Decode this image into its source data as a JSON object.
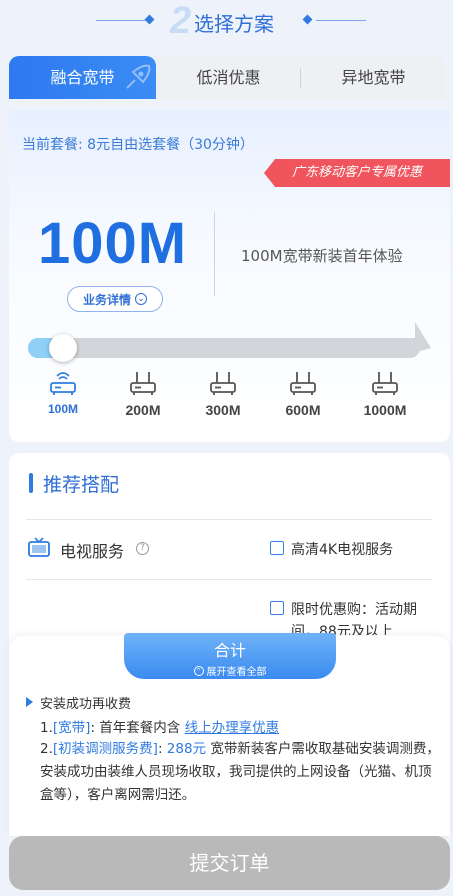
{
  "step": {
    "number": "2",
    "title": "选择方案"
  },
  "tabs": [
    {
      "label": "融合宽带",
      "active": true
    },
    {
      "label": "低消优惠",
      "active": false
    },
    {
      "label": "异地宽带",
      "active": false
    }
  ],
  "package": {
    "current": "当前套餐: 8元自由选套餐（30分钟）",
    "promo_badge": "广东移动客户专属优惠",
    "speed": "100M",
    "description": "100M宽带新装首年体验",
    "detail_button": "业务详情"
  },
  "speed_options": [
    {
      "label": "100M",
      "selected": true
    },
    {
      "label": "200M",
      "selected": false
    },
    {
      "label": "300M",
      "selected": false
    },
    {
      "label": "600M",
      "selected": false
    },
    {
      "label": "1000M",
      "selected": false
    }
  ],
  "recommend": {
    "title": "推荐搭配",
    "tv_label": "电视服务",
    "options": [
      {
        "label": "高清4K电视服务",
        "checked": false
      },
      {
        "label": "限时优惠购：活动期间，88元及以上",
        "checked": false
      }
    ]
  },
  "total": {
    "label": "合计",
    "expand": "展开查看全部"
  },
  "notice": {
    "title": "安装成功再收费",
    "item1_prefix": "1.",
    "item1_tag": "[宽带]",
    "item1_text": ": 首年套餐内含 ",
    "item1_link": "线上办理享优惠",
    "item2_prefix": "2.",
    "item2_tag": "[初装调测服务费]",
    "item2_sep": ": ",
    "item2_price": "288元",
    "item2_text": " 宽带新装客户需收取基础安装调测费，安装成功由装维人员现场收取，我司提供的上网设备（光猫、机顶盒等），客户离网需归还。"
  },
  "submit_label": "提交订单",
  "colors": {
    "primary": "#2f7be0",
    "promo": "#f0545c",
    "submit_disabled": "#b9b9b9",
    "slider_fill": "#8ed0f6"
  }
}
